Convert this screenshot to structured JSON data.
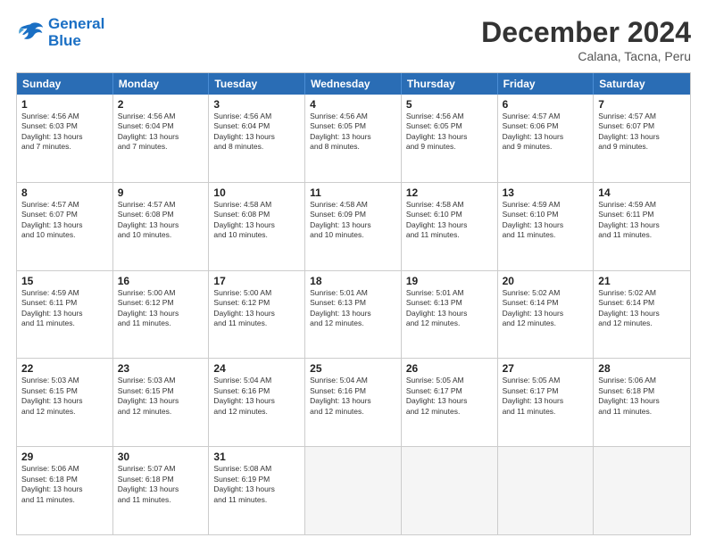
{
  "header": {
    "logo_general": "General",
    "logo_blue": "Blue",
    "month_title": "December 2024",
    "location": "Calana, Tacna, Peru"
  },
  "weekdays": [
    "Sunday",
    "Monday",
    "Tuesday",
    "Wednesday",
    "Thursday",
    "Friday",
    "Saturday"
  ],
  "rows": [
    [
      {
        "day": "1",
        "lines": [
          "Sunrise: 4:56 AM",
          "Sunset: 6:03 PM",
          "Daylight: 13 hours",
          "and 7 minutes."
        ]
      },
      {
        "day": "2",
        "lines": [
          "Sunrise: 4:56 AM",
          "Sunset: 6:04 PM",
          "Daylight: 13 hours",
          "and 7 minutes."
        ]
      },
      {
        "day": "3",
        "lines": [
          "Sunrise: 4:56 AM",
          "Sunset: 6:04 PM",
          "Daylight: 13 hours",
          "and 8 minutes."
        ]
      },
      {
        "day": "4",
        "lines": [
          "Sunrise: 4:56 AM",
          "Sunset: 6:05 PM",
          "Daylight: 13 hours",
          "and 8 minutes."
        ]
      },
      {
        "day": "5",
        "lines": [
          "Sunrise: 4:56 AM",
          "Sunset: 6:05 PM",
          "Daylight: 13 hours",
          "and 9 minutes."
        ]
      },
      {
        "day": "6",
        "lines": [
          "Sunrise: 4:57 AM",
          "Sunset: 6:06 PM",
          "Daylight: 13 hours",
          "and 9 minutes."
        ]
      },
      {
        "day": "7",
        "lines": [
          "Sunrise: 4:57 AM",
          "Sunset: 6:07 PM",
          "Daylight: 13 hours",
          "and 9 minutes."
        ]
      }
    ],
    [
      {
        "day": "8",
        "lines": [
          "Sunrise: 4:57 AM",
          "Sunset: 6:07 PM",
          "Daylight: 13 hours",
          "and 10 minutes."
        ]
      },
      {
        "day": "9",
        "lines": [
          "Sunrise: 4:57 AM",
          "Sunset: 6:08 PM",
          "Daylight: 13 hours",
          "and 10 minutes."
        ]
      },
      {
        "day": "10",
        "lines": [
          "Sunrise: 4:58 AM",
          "Sunset: 6:08 PM",
          "Daylight: 13 hours",
          "and 10 minutes."
        ]
      },
      {
        "day": "11",
        "lines": [
          "Sunrise: 4:58 AM",
          "Sunset: 6:09 PM",
          "Daylight: 13 hours",
          "and 10 minutes."
        ]
      },
      {
        "day": "12",
        "lines": [
          "Sunrise: 4:58 AM",
          "Sunset: 6:10 PM",
          "Daylight: 13 hours",
          "and 11 minutes."
        ]
      },
      {
        "day": "13",
        "lines": [
          "Sunrise: 4:59 AM",
          "Sunset: 6:10 PM",
          "Daylight: 13 hours",
          "and 11 minutes."
        ]
      },
      {
        "day": "14",
        "lines": [
          "Sunrise: 4:59 AM",
          "Sunset: 6:11 PM",
          "Daylight: 13 hours",
          "and 11 minutes."
        ]
      }
    ],
    [
      {
        "day": "15",
        "lines": [
          "Sunrise: 4:59 AM",
          "Sunset: 6:11 PM",
          "Daylight: 13 hours",
          "and 11 minutes."
        ]
      },
      {
        "day": "16",
        "lines": [
          "Sunrise: 5:00 AM",
          "Sunset: 6:12 PM",
          "Daylight: 13 hours",
          "and 11 minutes."
        ]
      },
      {
        "day": "17",
        "lines": [
          "Sunrise: 5:00 AM",
          "Sunset: 6:12 PM",
          "Daylight: 13 hours",
          "and 11 minutes."
        ]
      },
      {
        "day": "18",
        "lines": [
          "Sunrise: 5:01 AM",
          "Sunset: 6:13 PM",
          "Daylight: 13 hours",
          "and 12 minutes."
        ]
      },
      {
        "day": "19",
        "lines": [
          "Sunrise: 5:01 AM",
          "Sunset: 6:13 PM",
          "Daylight: 13 hours",
          "and 12 minutes."
        ]
      },
      {
        "day": "20",
        "lines": [
          "Sunrise: 5:02 AM",
          "Sunset: 6:14 PM",
          "Daylight: 13 hours",
          "and 12 minutes."
        ]
      },
      {
        "day": "21",
        "lines": [
          "Sunrise: 5:02 AM",
          "Sunset: 6:14 PM",
          "Daylight: 13 hours",
          "and 12 minutes."
        ]
      }
    ],
    [
      {
        "day": "22",
        "lines": [
          "Sunrise: 5:03 AM",
          "Sunset: 6:15 PM",
          "Daylight: 13 hours",
          "and 12 minutes."
        ]
      },
      {
        "day": "23",
        "lines": [
          "Sunrise: 5:03 AM",
          "Sunset: 6:15 PM",
          "Daylight: 13 hours",
          "and 12 minutes."
        ]
      },
      {
        "day": "24",
        "lines": [
          "Sunrise: 5:04 AM",
          "Sunset: 6:16 PM",
          "Daylight: 13 hours",
          "and 12 minutes."
        ]
      },
      {
        "day": "25",
        "lines": [
          "Sunrise: 5:04 AM",
          "Sunset: 6:16 PM",
          "Daylight: 13 hours",
          "and 12 minutes."
        ]
      },
      {
        "day": "26",
        "lines": [
          "Sunrise: 5:05 AM",
          "Sunset: 6:17 PM",
          "Daylight: 13 hours",
          "and 12 minutes."
        ]
      },
      {
        "day": "27",
        "lines": [
          "Sunrise: 5:05 AM",
          "Sunset: 6:17 PM",
          "Daylight: 13 hours",
          "and 11 minutes."
        ]
      },
      {
        "day": "28",
        "lines": [
          "Sunrise: 5:06 AM",
          "Sunset: 6:18 PM",
          "Daylight: 13 hours",
          "and 11 minutes."
        ]
      }
    ],
    [
      {
        "day": "29",
        "lines": [
          "Sunrise: 5:06 AM",
          "Sunset: 6:18 PM",
          "Daylight: 13 hours",
          "and 11 minutes."
        ]
      },
      {
        "day": "30",
        "lines": [
          "Sunrise: 5:07 AM",
          "Sunset: 6:18 PM",
          "Daylight: 13 hours",
          "and 11 minutes."
        ]
      },
      {
        "day": "31",
        "lines": [
          "Sunrise: 5:08 AM",
          "Sunset: 6:19 PM",
          "Daylight: 13 hours",
          "and 11 minutes."
        ]
      },
      null,
      null,
      null,
      null
    ]
  ]
}
